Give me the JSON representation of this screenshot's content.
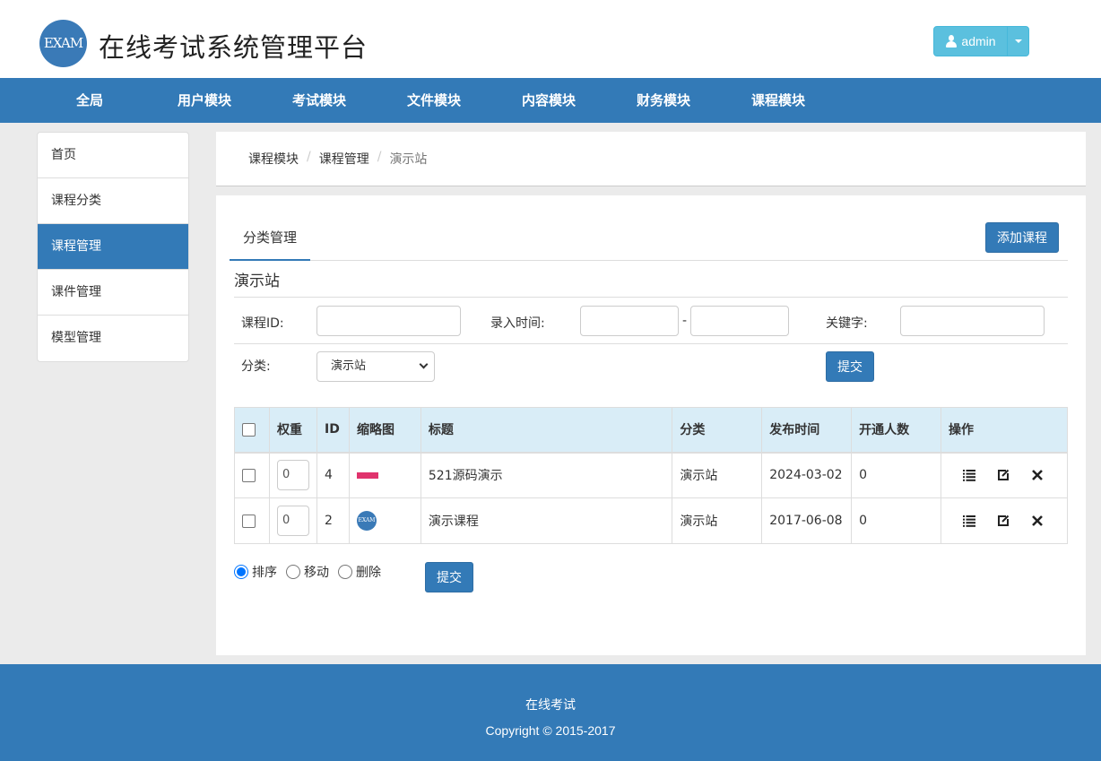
{
  "header": {
    "logo_text": "EXAM",
    "site_title": "在线考试系统管理平台",
    "user_label": "admin"
  },
  "nav": [
    {
      "label": "全局"
    },
    {
      "label": "用户模块"
    },
    {
      "label": "考试模块"
    },
    {
      "label": "文件模块"
    },
    {
      "label": "内容模块"
    },
    {
      "label": "财务模块"
    },
    {
      "label": "课程模块"
    }
  ],
  "sidebar": {
    "items": [
      {
        "label": "首页"
      },
      {
        "label": "课程分类"
      },
      {
        "label": "课程管理",
        "active": true
      },
      {
        "label": "课件管理"
      },
      {
        "label": "模型管理"
      }
    ]
  },
  "breadcrumb": [
    "课程模块",
    "课程管理",
    "演示站"
  ],
  "main": {
    "tab_label": "分类管理",
    "add_button": "添加课程",
    "section_title": "演示站",
    "search": {
      "course_id_label": "课程ID:",
      "course_id_value": "",
      "entry_time_label": "录入时间:",
      "time_from": "",
      "time_to": "",
      "range_sep": "-",
      "keyword_label": "关键字:",
      "keyword_value": "",
      "category_label": "分类:",
      "category_selected": "演示站",
      "submit_label": "提交"
    },
    "table": {
      "headers": [
        "权重",
        "ID",
        "缩略图",
        "标题",
        "分类",
        "发布时间",
        "开通人数",
        "操作"
      ],
      "rows": [
        {
          "weight": "0",
          "id": "4",
          "thumb": "thumb-banner",
          "title": "521源码演示",
          "category": "演示站",
          "publish_time": "2024-03-02",
          "enrolled": "0"
        },
        {
          "weight": "0",
          "id": "2",
          "thumb": "thumb-logo",
          "thumb_text": "EXAM",
          "title": "演示课程",
          "category": "演示站",
          "publish_time": "2017-06-08",
          "enrolled": "0"
        }
      ]
    },
    "actions": {
      "options": [
        {
          "label": "排序",
          "checked": true
        },
        {
          "label": "移动",
          "checked": false
        },
        {
          "label": "删除",
          "checked": false
        }
      ],
      "submit_label": "提交"
    }
  },
  "footer": {
    "line1": "在线考试",
    "line2": "Copyright © 2015-2017"
  },
  "colors": {
    "primary": "#337ab7",
    "info": "#5bc0de",
    "table_header": "#d9edf7",
    "thumb_red": "#e0336d"
  }
}
